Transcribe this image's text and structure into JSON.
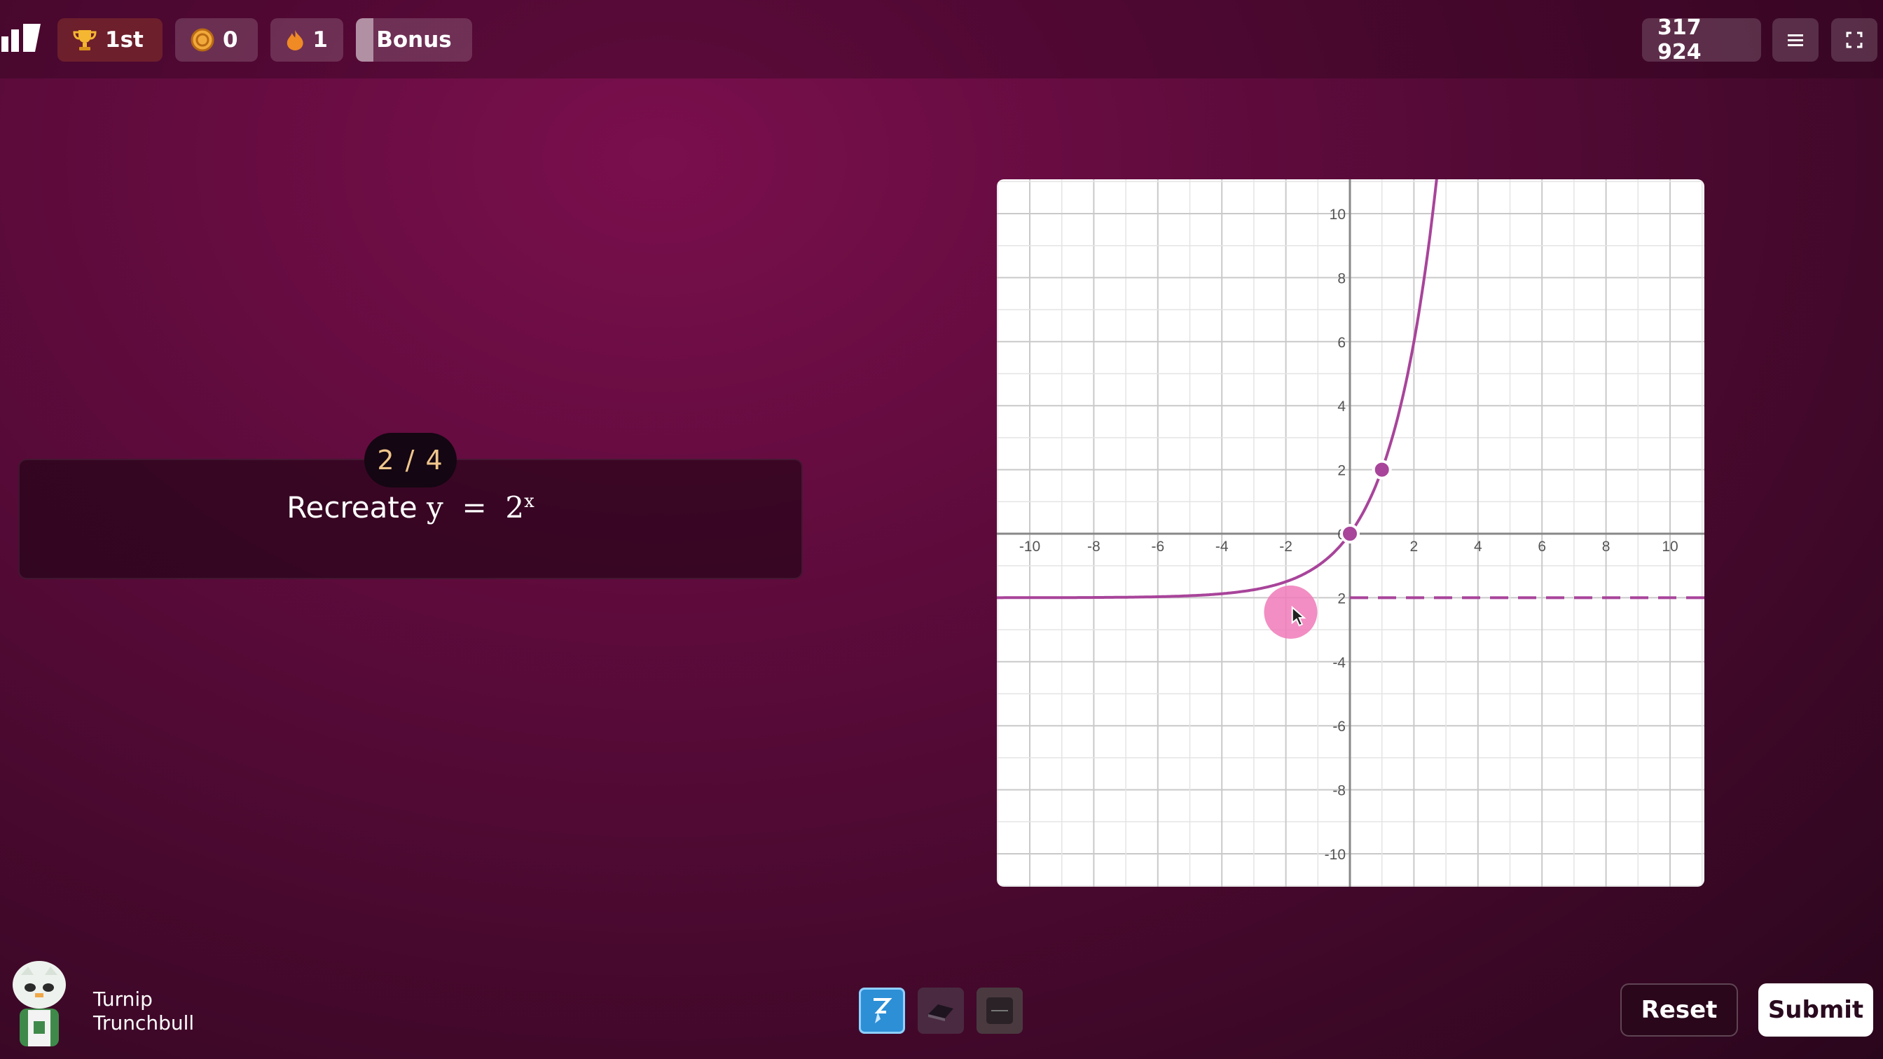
{
  "topbar": {
    "logo_icon": "game-logo-icon",
    "rank": {
      "icon": "trophy-icon",
      "label": "1st"
    },
    "coins": {
      "icon": "coin-icon",
      "value": "0"
    },
    "streak": {
      "icon": "fire-icon",
      "value": "1"
    },
    "bonus_label": "Bonus",
    "bonus_progress": 0.15,
    "score": "317 924",
    "menu_icon": "hamburger-menu-icon",
    "fullscreen_icon": "fullscreen-icon"
  },
  "question": {
    "counter": "2 / 4",
    "prompt_text": "Recreate",
    "equation_lhs": "y",
    "equation_op": "=",
    "equation_base": "2",
    "equation_exp": "x"
  },
  "graph": {
    "x_ticks": [
      "-10",
      "-8",
      "-6",
      "-4",
      "-2",
      "2",
      "4",
      "6",
      "8",
      "10"
    ],
    "y_ticks": [
      "10",
      "8",
      "6",
      "4",
      "2",
      "0",
      "2",
      "-4",
      "-6",
      "-8",
      "-10"
    ],
    "curve_color": "#a8449a",
    "cursor_color": "#f07ab8",
    "handle_points": [
      {
        "x": 0,
        "y": 0
      },
      {
        "x": 1,
        "y": 2
      }
    ],
    "asymptote_y": -2
  },
  "player": {
    "first_name": "Turnip",
    "last_name": "Trunchbull",
    "avatar_icon": "robot-avatar-icon"
  },
  "tools": [
    {
      "name": "pen-tool",
      "icon": "pen-icon",
      "active": true
    },
    {
      "name": "eraser-tool",
      "icon": "eraser-icon",
      "active": false
    },
    {
      "name": "fifty-fifty-tool",
      "icon": "fifty-fifty-icon",
      "active": false
    }
  ],
  "actions": {
    "reset_label": "Reset",
    "submit_label": "Submit"
  }
}
